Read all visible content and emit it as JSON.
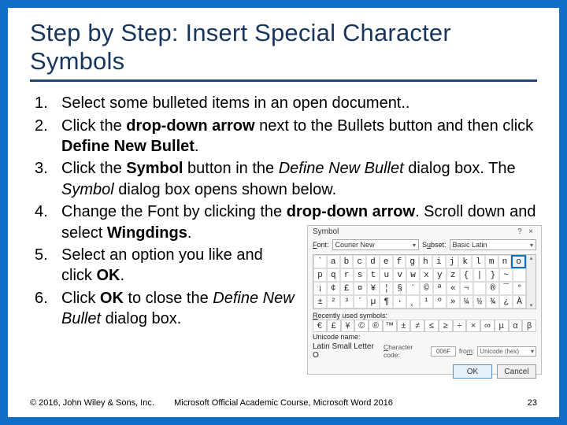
{
  "title": "Step by Step: Insert Special Character Symbols",
  "steps": {
    "s1": "Select some bulleted items in an open document..",
    "s2_a": "Click the ",
    "s2_b": "drop-down arrow",
    "s2_c": " next to the Bullets button and then click ",
    "s2_d": "Define New Bullet",
    "s2_e": ".",
    "s3_a": "Click the ",
    "s3_b": "Symbol",
    "s3_c": " button in the ",
    "s3_d": "Define New Bullet",
    "s3_e": " dialog box. The ",
    "s3_f": "Symbol",
    "s3_g": " dialog box opens shown below.",
    "s4_a": "Change the Font by clicking the ",
    "s4_b": "drop-down arrow",
    "s4_c": ". Scroll down and select ",
    "s4_d": "Wingdings",
    "s4_e": ".",
    "s5_a": "Select an option you like and click ",
    "s5_b": "OK",
    "s5_c": ".",
    "s6_a": "Click ",
    "s6_b": "OK",
    "s6_c": " to close the ",
    "s6_d": "Define New Bullet",
    "s6_e": " dialog box."
  },
  "dialog": {
    "title": "Symbol",
    "help": "?",
    "close": "×",
    "font_label": "Font:",
    "font_value": "Courier New",
    "subset_label": "Subset:",
    "subset_value": "Basic Latin",
    "grid_rows": [
      [
        "`",
        "a",
        "b",
        "c",
        "d",
        "e",
        "f",
        "g",
        "h",
        "i",
        "j",
        "k",
        "l",
        "m",
        "n",
        "o"
      ],
      [
        "p",
        "q",
        "r",
        "s",
        "t",
        "u",
        "v",
        "w",
        "x",
        "y",
        "z",
        "{",
        "|",
        "}",
        "~",
        " "
      ],
      [
        "¡",
        "¢",
        "£",
        "¤",
        "¥",
        "¦",
        "§",
        "¨",
        "©",
        "ª",
        "«",
        "¬",
        "­",
        "®",
        "¯",
        "°"
      ],
      [
        "±",
        "²",
        "³",
        "´",
        "µ",
        "¶",
        "·",
        "¸",
        "¹",
        "º",
        "»",
        "¼",
        "½",
        "¾",
        "¿",
        "À"
      ]
    ],
    "selected": [
      0,
      15
    ],
    "recent_label": "Recently used symbols:",
    "recent": [
      "€",
      "£",
      "¥",
      "©",
      "®",
      "™",
      "±",
      "≠",
      "≤",
      "≥",
      "÷",
      "×",
      "∞",
      "µ",
      "α",
      "β"
    ],
    "unicode_name_label": "Unicode name:",
    "unicode_name": "Latin Small Letter O",
    "char_code_label": "Character code:",
    "char_code": "006F",
    "from_label": "from:",
    "from_value": "Unicode (hex)",
    "ok": "OK",
    "cancel": "Cancel"
  },
  "footer": {
    "left": "© 2016, John Wiley & Sons, Inc.",
    "center": "Microsoft Official Academic Course, Microsoft Word 2016",
    "right": "23"
  }
}
